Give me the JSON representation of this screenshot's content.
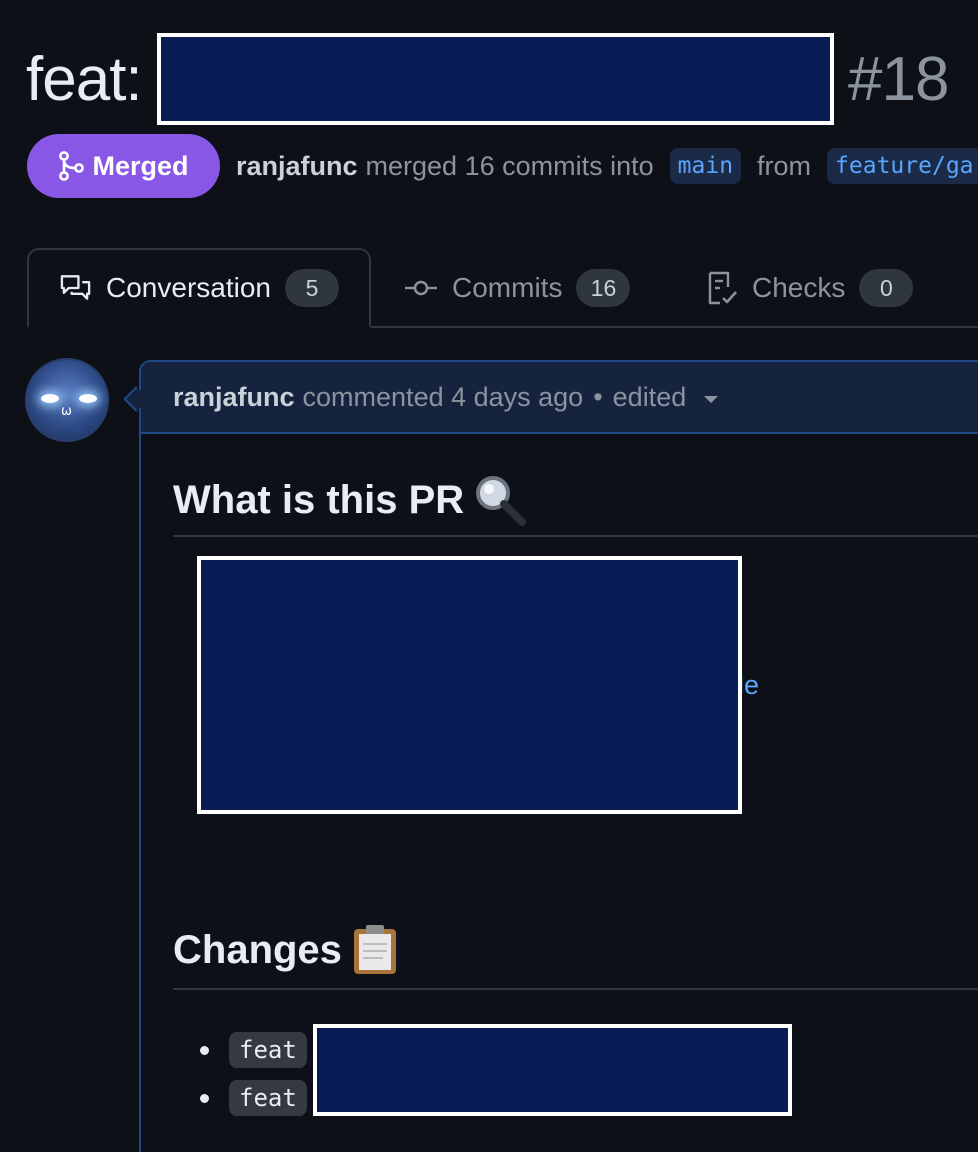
{
  "pr": {
    "title_prefix": "feat:",
    "number": "#18",
    "state": "Merged",
    "author": "ranjafunc",
    "merge_text": "merged 16 commits into",
    "base_branch": "main",
    "from_text": "from",
    "head_branch": "feature/ga"
  },
  "tabs": [
    {
      "label": "Conversation",
      "count": "5",
      "icon": "comment-discussion-icon",
      "active": true
    },
    {
      "label": "Commits",
      "count": "16",
      "icon": "git-commit-icon",
      "active": false
    },
    {
      "label": "Checks",
      "count": "0",
      "icon": "checklist-icon",
      "active": false
    }
  ],
  "comment": {
    "author": "ranjafunc",
    "action": "commented 4 days ago",
    "separator": "•",
    "edited": "edited",
    "sections": [
      {
        "heading": "What is this PR",
        "emoji": "magnifying-glass"
      },
      {
        "heading": "Changes",
        "emoji": "clipboard"
      }
    ],
    "link_tail": "le",
    "changes": [
      {
        "prefix": "feat"
      },
      {
        "prefix": "feat"
      }
    ]
  },
  "colors": {
    "background": "#0d1117",
    "merged": "#8957e5",
    "link": "#58a6ff",
    "comment_border": "#1f4a86",
    "comment_header": "#16233f",
    "redaction": "#0a1c55"
  }
}
